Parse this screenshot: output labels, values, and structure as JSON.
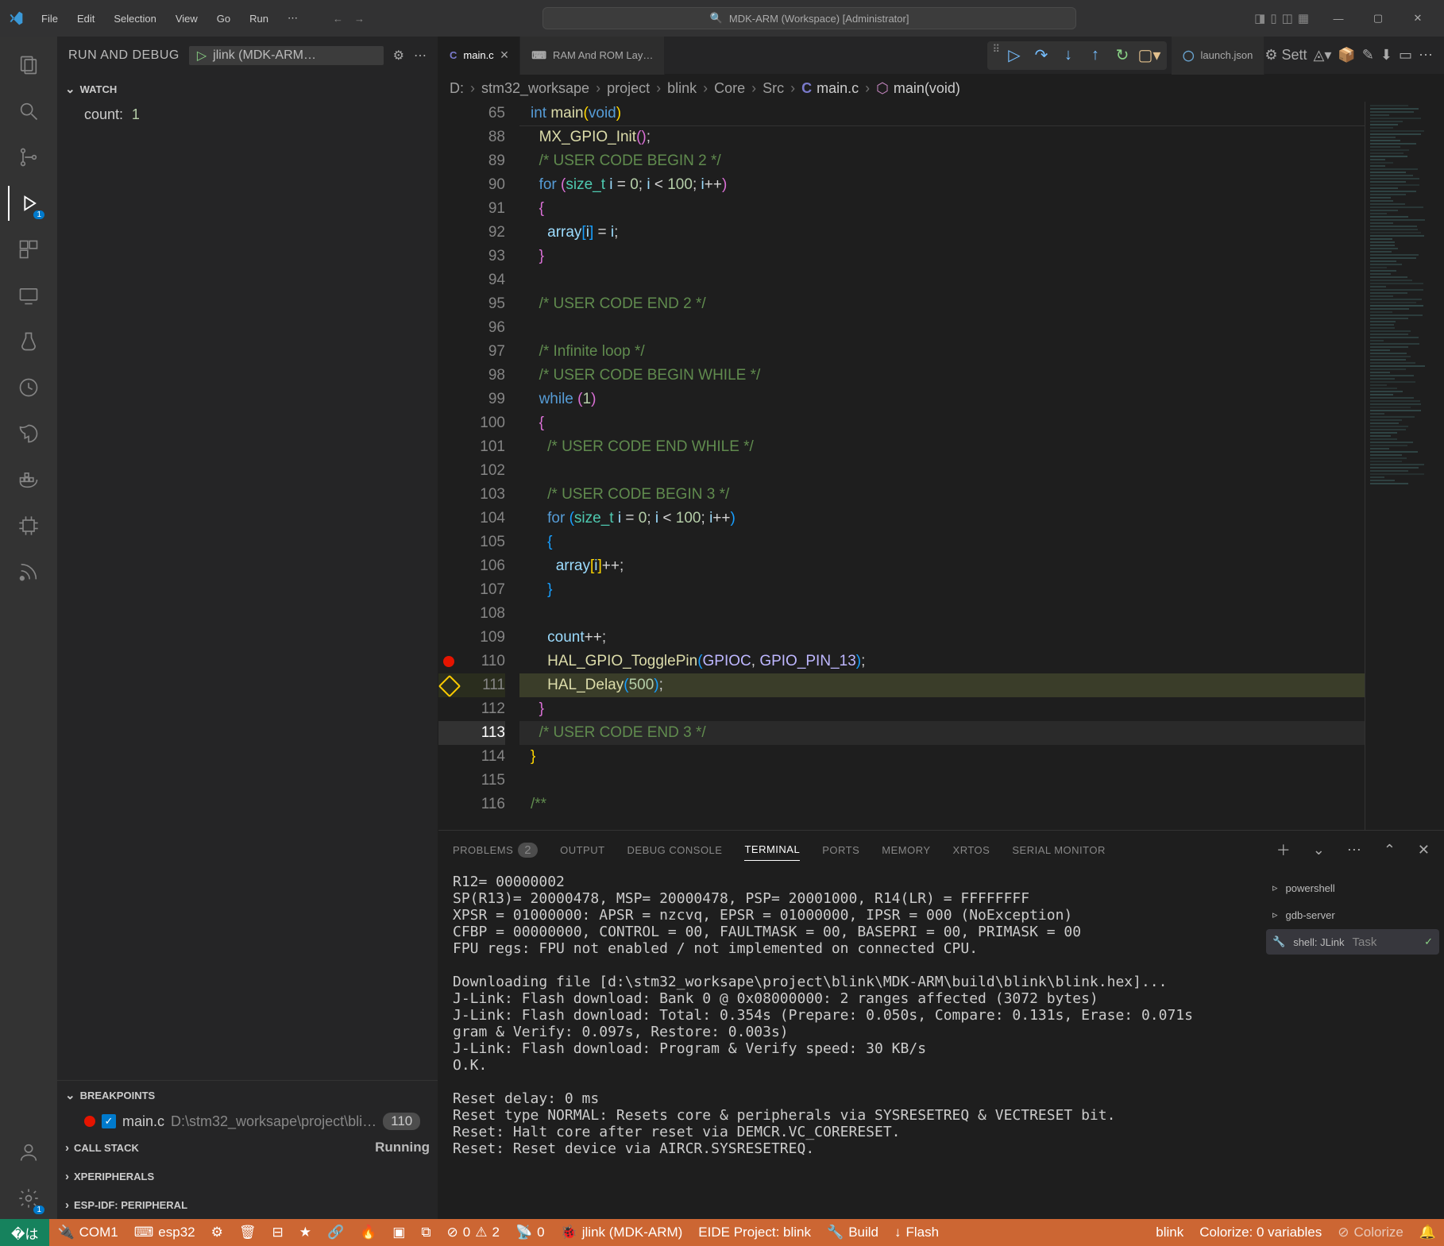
{
  "title": "MDK-ARM (Workspace) [Administrator]",
  "menu": [
    "File",
    "Edit",
    "Selection",
    "View",
    "Go",
    "Run",
    "⋯"
  ],
  "sidebar_title": "RUN AND DEBUG",
  "debug_config": "jlink (MDK-ARM…",
  "sections": {
    "watch": "WATCH",
    "breakpoints": "BREAKPOINTS",
    "callstack": "CALL STACK",
    "xperipherals": "XPERIPHERALS",
    "espidf": "ESP-IDF: PERIPHERAL"
  },
  "watch_items": [
    {
      "expr": "count:",
      "val": "1"
    }
  ],
  "bp_items": [
    {
      "file": "main.c",
      "path": "D:\\stm32_worksape\\project\\bli…",
      "line": "110"
    }
  ],
  "run_state": "Running",
  "tabs": [
    {
      "icon": "C",
      "label": "main.c",
      "active": true,
      "close": true
    },
    {
      "icon": "⌨",
      "label": "RAM And ROM Lay…",
      "active": false,
      "close": false
    },
    {
      "icon": "◯",
      "label": "launch.json",
      "active": false,
      "close": false
    }
  ],
  "breadcrumb": [
    "D:",
    "stm32_worksape",
    "project",
    "blink",
    "Core",
    "Src",
    "main.c",
    "main(void)"
  ],
  "code_sticky": {
    "num": "65",
    "html": "<span class='kw'>int</span> <span class='fn'>main</span><span class='br1'>(</span><span class='kw'>void</span><span class='br1'>)</span>"
  },
  "code": [
    {
      "n": "88",
      "h": "  <span class='fn'>MX_GPIO_Init</span><span class='br2'>(</span><span class='br2'>)</span>;"
    },
    {
      "n": "89",
      "h": "  <span class='cm'>/* USER CODE BEGIN 2 */</span>"
    },
    {
      "n": "90",
      "h": "  <span class='kw'>for</span> <span class='br2'>(</span><span class='ty'>size_t</span> <span class='id'>i</span> <span class='op'>=</span> <span class='nm'>0</span>; <span class='id'>i</span> <span class='op'>&lt;</span> <span class='nm'>100</span>; <span class='id'>i</span><span class='op'>++</span><span class='br2'>)</span>"
    },
    {
      "n": "91",
      "h": "  <span class='br2'>{</span>"
    },
    {
      "n": "92",
      "h": "    <span class='id'>array</span><span class='br3'>[</span><span class='id'>i</span><span class='br3'>]</span> <span class='op'>=</span> <span class='id'>i</span>;"
    },
    {
      "n": "93",
      "h": "  <span class='br2'>}</span>"
    },
    {
      "n": "94",
      "h": ""
    },
    {
      "n": "95",
      "h": "  <span class='cm'>/* USER CODE END 2 */</span>"
    },
    {
      "n": "96",
      "h": ""
    },
    {
      "n": "97",
      "h": "  <span class='cm'>/* Infinite loop */</span>"
    },
    {
      "n": "98",
      "h": "  <span class='cm'>/* USER CODE BEGIN WHILE */</span>"
    },
    {
      "n": "99",
      "h": "  <span class='kw'>while</span> <span class='br2'>(</span><span class='nm'>1</span><span class='br2'>)</span>"
    },
    {
      "n": "100",
      "h": "  <span class='br2'>{</span>"
    },
    {
      "n": "101",
      "h": "    <span class='cm'>/* USER CODE END WHILE */</span>"
    },
    {
      "n": "102",
      "h": ""
    },
    {
      "n": "103",
      "h": "    <span class='cm'>/* USER CODE BEGIN 3 */</span>"
    },
    {
      "n": "104",
      "h": "    <span class='kw'>for</span> <span class='br3'>(</span><span class='ty'>size_t</span> <span class='id'>i</span> <span class='op'>=</span> <span class='nm'>0</span>; <span class='id'>i</span> <span class='op'>&lt;</span> <span class='nm'>100</span>; <span class='id'>i</span><span class='op'>++</span><span class='br3'>)</span>"
    },
    {
      "n": "105",
      "h": "    <span class='br3'>{</span>"
    },
    {
      "n": "106",
      "h": "      <span class='id'>array</span><span class='br1'>[</span><span class='id'>i</span><span class='br1'>]</span><span class='op'>++</span>;"
    },
    {
      "n": "107",
      "h": "    <span class='br3'>}</span>"
    },
    {
      "n": "108",
      "h": ""
    },
    {
      "n": "109",
      "h": "    <span class='id'>count</span><span class='op'>++</span>;"
    },
    {
      "n": "110",
      "bp": true,
      "h": "    <span class='fn'>HAL_GPIO_TogglePin</span><span class='br3'>(</span><span class='mc'>GPIOC</span>, <span class='mc'>GPIO_PIN_13</span><span class='br3'>)</span>;"
    },
    {
      "n": "111",
      "cur": true,
      "hl": true,
      "h": "    <span class='fn'>HAL_Delay</span><span class='br3'>(</span><span class='nm'>500</span><span class='br3'>)</span>;"
    },
    {
      "n": "112",
      "h": "  <span class='br2'>}</span>"
    },
    {
      "n": "113",
      "sel": true,
      "h": "  <span class='cm'>/* USER CODE END 3 */</span>"
    },
    {
      "n": "114",
      "h": "<span class='br1'>}</span>"
    },
    {
      "n": "115",
      "h": ""
    },
    {
      "n": "116",
      "h": "<span class='cm'>/**</span>"
    }
  ],
  "panel_tabs": [
    {
      "label": "PROBLEMS",
      "badge": "2"
    },
    {
      "label": "OUTPUT"
    },
    {
      "label": "DEBUG CONSOLE"
    },
    {
      "label": "TERMINAL",
      "active": true
    },
    {
      "label": "PORTS"
    },
    {
      "label": "MEMORY"
    },
    {
      "label": "XRTOS"
    },
    {
      "label": "SERIAL MONITOR"
    }
  ],
  "terminal_output": "R12= 00000002\nSP(R13)= 20000478, MSP= 20000478, PSP= 20001000, R14(LR) = FFFFFFFF\nXPSR = 01000000: APSR = nzcvq, EPSR = 01000000, IPSR = 000 (NoException)\nCFBP = 00000000, CONTROL = 00, FAULTMASK = 00, BASEPRI = 00, PRIMASK = 00\nFPU regs: FPU not enabled / not implemented on connected CPU.\n\nDownloading file [d:\\stm32_worksape\\project\\blink\\MDK-ARM\\build\\blink\\blink.hex]...\nJ-Link: Flash download: Bank 0 @ 0x08000000: 2 ranges affected (3072 bytes)\nJ-Link: Flash download: Total: 0.354s (Prepare: 0.050s, Compare: 0.131s, Erase: 0.071s\ngram & Verify: 0.097s, Restore: 0.003s)\nJ-Link: Flash download: Program & Verify speed: 30 KB/s\nO.K.\n\nReset delay: 0 ms\nReset type NORMAL: Resets core & peripherals via SYSRESETREQ & VECTRESET bit.\nReset: Halt core after reset via DEMCR.VC_CORERESET.\nReset: Reset device via AIRCR.SYSRESETREQ.",
  "terminal_list": [
    {
      "icon": "▹",
      "label": "powershell"
    },
    {
      "icon": "▹",
      "label": "gdb-server"
    },
    {
      "icon": "🔧",
      "label": "shell: JLink",
      "task": "Task",
      "active": true,
      "check": true
    }
  ],
  "statusbar": {
    "com": "COM1",
    "esp": "esp32",
    "errors": "0",
    "warnings": "2",
    "radio": "0",
    "debug": "jlink (MDK-ARM)",
    "project": "EIDE Project: blink",
    "build": "Build",
    "flash": "Flash",
    "target": "blink",
    "colorize": "Colorize: 0 variables",
    "colorize2": "Colorize"
  },
  "editor_actions_right": [
    "⚙ Sett",
    "◬▾",
    "📦",
    "✎",
    "⬇",
    "▭",
    "⋯"
  ]
}
